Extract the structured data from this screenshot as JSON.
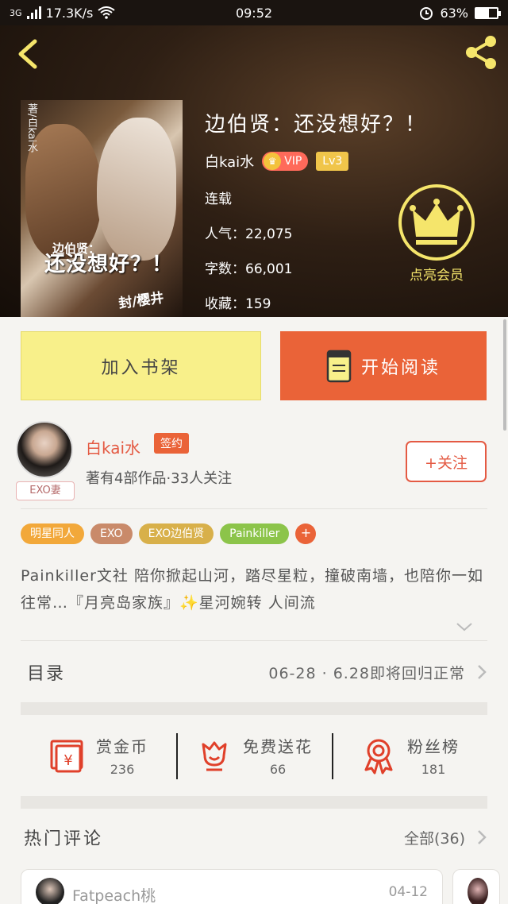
{
  "status_bar": {
    "network": "3G",
    "speed": "17.3K/s",
    "time": "09:52",
    "battery": "63%",
    "battery_level": 0.63
  },
  "book": {
    "title": "边伯贤：还没想好？！",
    "author": "白kai水",
    "vip_label": "VIP",
    "level": "Lv3",
    "status": "连载",
    "popularity_label": "人气：",
    "popularity": "22,075",
    "words_label": "字数：",
    "words": "66,001",
    "favorites_label": "收藏：",
    "favorites": "159",
    "vip_cta": "点亮会员",
    "cover": {
      "vertical_text": "著/白kai水",
      "subtitle": "边伯贤：",
      "title": "还没想好？！",
      "artist": "封/樱井"
    }
  },
  "actions": {
    "add_shelf": "加入书架",
    "start_read": "开始阅读"
  },
  "author_section": {
    "name": "白kai水",
    "sign_badge": "签约",
    "stats": "著有4部作品·33人关注",
    "follow": "+关注",
    "avatar_tag": "EXO妻"
  },
  "tags": [
    {
      "label": "明星同人",
      "color": "#f2a83a"
    },
    {
      "label": "EXO",
      "color": "#c98a6a"
    },
    {
      "label": "EXO边伯贤",
      "color": "#d8b04a"
    },
    {
      "label": "Painkiller",
      "color": "#8cc44a"
    }
  ],
  "tag_more": "+",
  "description": "Painkiller文社 陪你掀起山河，踏尽星粒，撞破南墙，也陪你一如往常…『月亮岛家族』✨星河婉转 人间流",
  "catalog": {
    "label": "目录",
    "latest": "06-28 · 6.28即将回归正常"
  },
  "stats": [
    {
      "icon": "red-envelope-icon",
      "label": "赏金币",
      "value": "236"
    },
    {
      "icon": "flower-icon",
      "label": "免费送花",
      "value": "66"
    },
    {
      "icon": "medal-icon",
      "label": "粉丝榜",
      "value": "181"
    }
  ],
  "comments": {
    "title": "热门评论",
    "all": "全部(36)",
    "first": {
      "user": "Fatpeach桃",
      "date": "04-12"
    }
  },
  "colors": {
    "accent": "#ea6338",
    "shelf_button": "#f8f08a",
    "vip_gold": "#f5e56b"
  }
}
